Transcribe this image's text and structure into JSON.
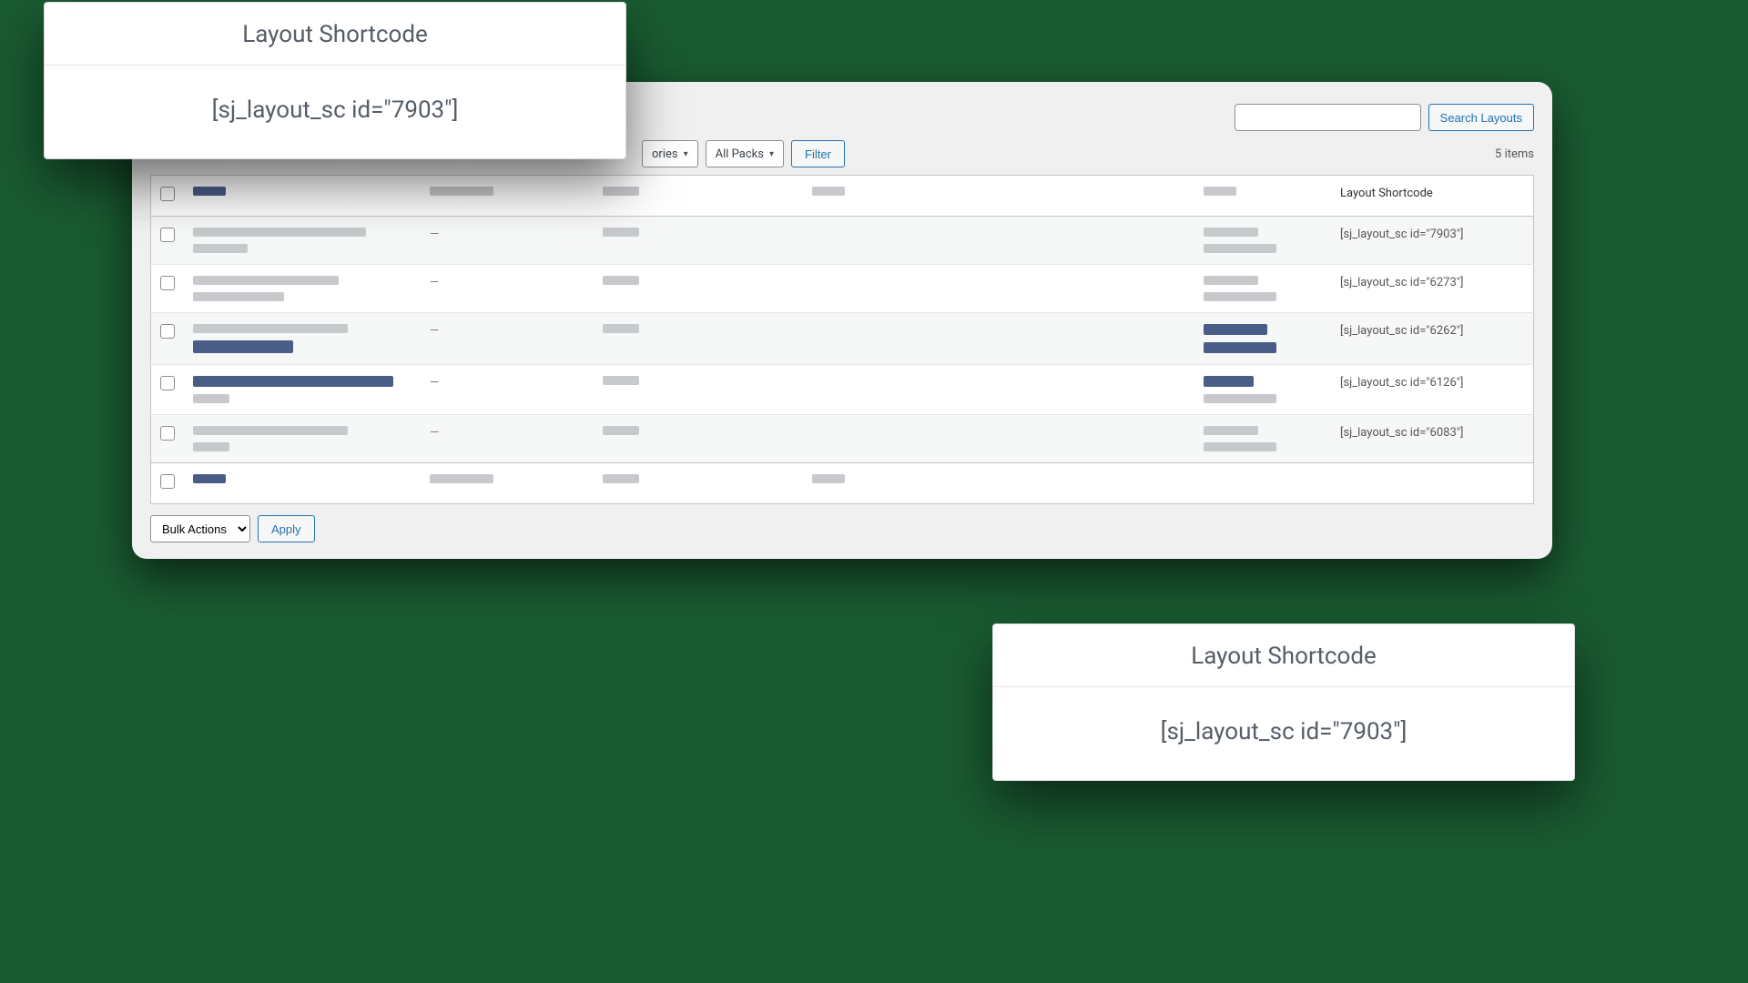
{
  "filters": {
    "categories_label": "ories",
    "packs_label": "All Packs",
    "filter_button": "Filter",
    "items_count": "5 items"
  },
  "search": {
    "placeholder": "",
    "button": "Search Layouts"
  },
  "columns": {
    "shortcode": "Layout Shortcode"
  },
  "rows": [
    {
      "shortcode": "[sj_layout_sc id=\"7903\"]",
      "author_dash": true
    },
    {
      "shortcode": "[sj_layout_sc id=\"6273\"]",
      "author_dash": true
    },
    {
      "shortcode": "[sj_layout_sc id=\"6262\"]",
      "author_dash": true,
      "title_dark": true,
      "date_dark": true
    },
    {
      "shortcode": "[sj_layout_sc id=\"6126\"]",
      "author_dash": true,
      "title_dark": true,
      "date_dark": true
    },
    {
      "shortcode": "[sj_layout_sc id=\"6083\"]",
      "author_dash": true
    }
  ],
  "bulk": {
    "actions_label": "Bulk Actions",
    "apply_label": "Apply"
  },
  "callouts": {
    "title": "Layout Shortcode",
    "value": "[sj_layout_sc id=\"7903\"]"
  }
}
